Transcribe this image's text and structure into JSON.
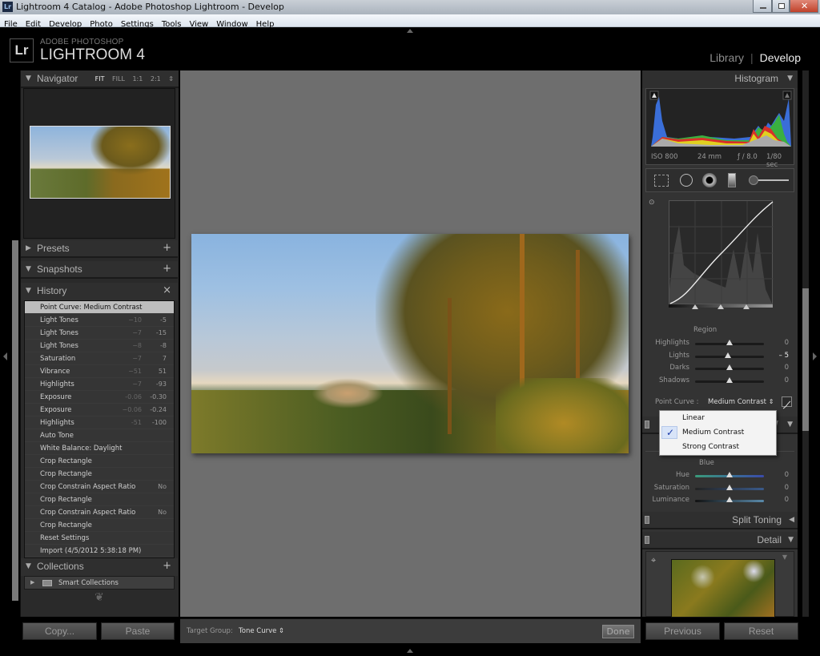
{
  "window": {
    "title": "Lightroom 4 Catalog - Adobe Photoshop Lightroom - Develop",
    "app_icon": "Lr",
    "controls": [
      "minimize-icon",
      "restore-icon",
      "close-icon"
    ]
  },
  "menu": [
    "File",
    "Edit",
    "Develop",
    "Photo",
    "Settings",
    "Tools",
    "View",
    "Window",
    "Help"
  ],
  "branding": {
    "logo": "Lr",
    "line1": "ADOBE PHOTOSHOP",
    "line2": "LIGHTROOM 4"
  },
  "modules": {
    "library": "Library",
    "separator": "|",
    "develop": "Develop"
  },
  "left_panel": {
    "navigator": {
      "title": "Navigator",
      "zoom_options": [
        "FIT",
        "FILL",
        "1:1",
        "2:1"
      ],
      "active_zoom": "FIT"
    },
    "presets": {
      "title": "Presets",
      "action": "+"
    },
    "snapshots": {
      "title": "Snapshots",
      "action": "+"
    },
    "history": {
      "title": "History",
      "action": "×",
      "items": [
        {
          "name": "Point Curve: Medium Contrast",
          "from": "",
          "to": "",
          "selected": true
        },
        {
          "name": "Light Tones",
          "from": "−10",
          "to": "-5"
        },
        {
          "name": "Light Tones",
          "from": "−7",
          "to": "-15"
        },
        {
          "name": "Light Tones",
          "from": "−8",
          "to": "-8"
        },
        {
          "name": "Saturation",
          "from": "−7",
          "to": "7"
        },
        {
          "name": "Vibrance",
          "from": "−51",
          "to": "51"
        },
        {
          "name": "Highlights",
          "from": "−7",
          "to": "-93"
        },
        {
          "name": "Exposure",
          "from": "-0.06",
          "to": "-0.30"
        },
        {
          "name": "Exposure",
          "from": "−0.06",
          "to": "-0.24"
        },
        {
          "name": "Highlights",
          "from": "-51",
          "to": "-100"
        },
        {
          "name": "Auto Tone",
          "from": "",
          "to": ""
        },
        {
          "name": "White Balance: Daylight",
          "from": "",
          "to": ""
        },
        {
          "name": "Crop Rectangle",
          "from": "",
          "to": ""
        },
        {
          "name": "Crop Rectangle",
          "from": "",
          "to": ""
        },
        {
          "name": "Crop Constrain Aspect Ratio",
          "from": "",
          "to": "No"
        },
        {
          "name": "Crop Rectangle",
          "from": "",
          "to": ""
        },
        {
          "name": "Crop Constrain Aspect Ratio",
          "from": "",
          "to": "No"
        },
        {
          "name": "Crop Rectangle",
          "from": "",
          "to": ""
        },
        {
          "name": "Reset Settings",
          "from": "",
          "to": ""
        },
        {
          "name": "Import (4/5/2012 5:38:18 PM)",
          "from": "",
          "to": ""
        }
      ]
    },
    "collections": {
      "title": "Collections",
      "action": "+",
      "items": [
        {
          "name": "Smart Collections"
        }
      ]
    },
    "copy_button": "Copy...",
    "paste_button": "Paste"
  },
  "toolbar": {
    "target_group_label": "Target Group:",
    "target_group_value": "Tone Curve",
    "done_button": "Done"
  },
  "right_panel": {
    "histogram": {
      "title": "Histogram",
      "iso": "ISO 800",
      "focal": "24 mm",
      "aperture": "ƒ / 8.0",
      "shutter": "1/80 sec"
    },
    "tone_curve": {
      "region_label": "Region",
      "sliders": [
        {
          "label": "Highlights",
          "value": "0",
          "position": 0.5
        },
        {
          "label": "Lights",
          "value": "– 5",
          "position": 0.475
        },
        {
          "label": "Darks",
          "value": "0",
          "position": 0.5
        },
        {
          "label": "Shadows",
          "value": "0",
          "position": 0.5
        }
      ],
      "point_curve_label": "Point Curve :",
      "point_curve_value": "Medium Contrast",
      "dropdown_options": [
        {
          "label": "Linear",
          "checked": false
        },
        {
          "label": "Medium Contrast",
          "checked": true
        },
        {
          "label": "Strong Contrast",
          "checked": false
        }
      ]
    },
    "hsl": {
      "group": "Blue",
      "sliders": [
        {
          "label": "Hue",
          "value": "0",
          "position": 0.5
        },
        {
          "label": "Saturation",
          "value": "0",
          "position": 0.5
        },
        {
          "label": "Luminance",
          "value": "0",
          "position": 0.5
        }
      ]
    },
    "split_toning": {
      "title": "Split Toning"
    },
    "detail": {
      "title": "Detail"
    },
    "previous_button": "Previous",
    "reset_button": "Reset"
  }
}
